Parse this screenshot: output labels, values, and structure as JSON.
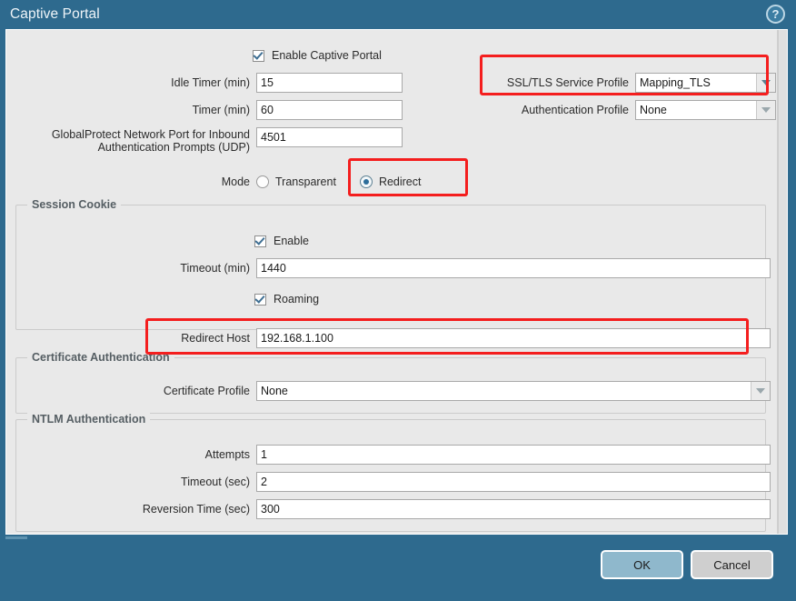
{
  "window": {
    "title": "Captive Portal",
    "help_icon": "help-circle-icon",
    "help_glyph": "?"
  },
  "colors": {
    "titlebar": "#2e6a8e",
    "panel": "#e9e9e9",
    "annotation": "#f41e1e",
    "accent": "#2d6d9a",
    "ok_button": "#8fb8cc",
    "cancel_button": "#cfcfcf"
  },
  "form": {
    "enable_captive_portal": {
      "label": "Enable Captive Portal",
      "checked": true
    },
    "idle_timer": {
      "label": "Idle Timer (min)",
      "value": "15"
    },
    "timer": {
      "label": "Timer (min)",
      "value": "60"
    },
    "globalprotect_port": {
      "label_line1": "GlobalProtect Network Port for Inbound",
      "label_line2": "Authentication Prompts (UDP)",
      "value": "4501"
    },
    "ssl_tls_service_profile": {
      "label": "SSL/TLS Service Profile",
      "value": "Mapping_TLS",
      "highlighted": true
    },
    "authentication_profile": {
      "label": "Authentication Profile",
      "value": "None",
      "highlighted": false
    },
    "mode": {
      "label": "Mode",
      "options": [
        {
          "label": "Transparent",
          "selected": false
        },
        {
          "label": "Redirect",
          "selected": true
        }
      ],
      "highlighted_option": "Redirect"
    }
  },
  "session_cookie": {
    "title": "Session Cookie",
    "enable": {
      "label": "Enable",
      "checked": true
    },
    "timeout": {
      "label": "Timeout (min)",
      "value": "1440"
    },
    "roaming": {
      "label": "Roaming",
      "checked": true
    }
  },
  "redirect_host": {
    "label": "Redirect Host",
    "value": "192.168.1.100",
    "highlighted": true
  },
  "certificate_authentication": {
    "title": "Certificate Authentication",
    "certificate_profile": {
      "label": "Certificate Profile",
      "value": "None"
    }
  },
  "ntlm_authentication": {
    "title": "NTLM Authentication",
    "attempts": {
      "label": "Attempts",
      "value": "1"
    },
    "timeout": {
      "label": "Timeout (sec)",
      "value": "2"
    },
    "reversion_time": {
      "label": "Reversion Time (sec)",
      "value": "300"
    }
  },
  "footer": {
    "ok_label": "OK",
    "cancel_label": "Cancel"
  }
}
